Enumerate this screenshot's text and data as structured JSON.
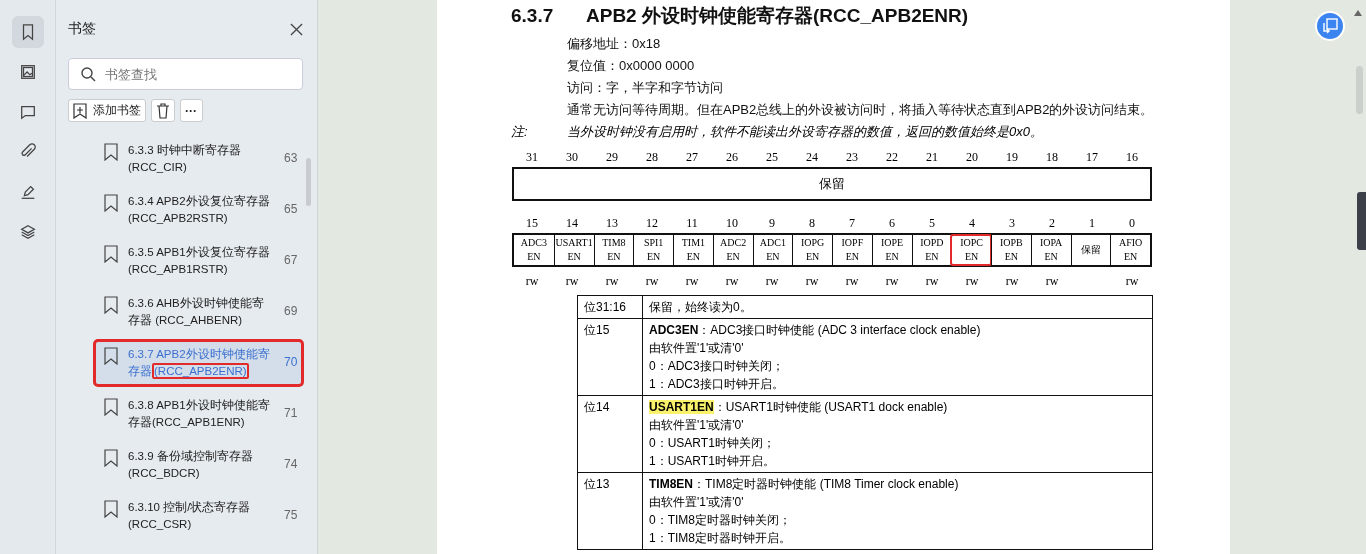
{
  "rail": [
    {
      "kind": "bookmark",
      "selected": true
    },
    {
      "kind": "image",
      "selected": false
    },
    {
      "kind": "comment",
      "selected": false
    },
    {
      "kind": "attachment",
      "selected": false
    },
    {
      "kind": "sign",
      "selected": false
    },
    {
      "kind": "layers",
      "selected": false
    }
  ],
  "panel": {
    "title": "书签",
    "search": {
      "placeholder": "书签查找"
    },
    "add_button": "添加书签",
    "more_button": "···",
    "items": [
      {
        "title": "6.3.3 时钟中断寄存器 (RCC_CIR)",
        "page": "63",
        "selected": false
      },
      {
        "title": "6.3.4 APB2外设复位寄存器 (RCC_APB2RSTR)",
        "page": "65",
        "selected": false
      },
      {
        "title": "6.3.5 APB1外设复位寄存器 (RCC_APB1RSTR)",
        "page": "67",
        "selected": false
      },
      {
        "title": "6.3.6 AHB外设时钟使能寄存器 (RCC_AHBENR)",
        "page": "69",
        "selected": false
      },
      {
        "title": "6.3.7 APB2外设时钟使能寄存器",
        "boxed": "(RCC_APB2ENR)",
        "page": "70",
        "selected": true
      },
      {
        "title": "6.3.8 APB1外设时钟使能寄存器(RCC_APB1ENR)",
        "page": "71",
        "selected": false
      },
      {
        "title": "6.3.9 备份域控制寄存器 (RCC_BDCR)",
        "page": "74",
        "selected": false
      },
      {
        "title": "6.3.10 控制/状态寄存器 (RCC_CSR)",
        "page": "75",
        "selected": false
      }
    ]
  },
  "doc": {
    "number": "6.3.7",
    "title": "APB2 外设时钟使能寄存器(RCC_APB2ENR)",
    "lines": [
      "偏移地址：0x18",
      "复位值：0x0000 0000",
      "访问：字，半字和字节访问",
      "通常无访问等待周期。但在APB2总线上的外设被访问时，将插入等待状态直到APB2的外设访问结束。"
    ],
    "note_label": "注:",
    "note": "当外设时钟没有启用时，软件不能读出外设寄存器的数值，返回的数值始终是0x0。",
    "high_bits": [
      "31",
      "30",
      "29",
      "28",
      "27",
      "26",
      "25",
      "24",
      "23",
      "22",
      "21",
      "20",
      "19",
      "18",
      "17",
      "16"
    ],
    "high_reserved": "保留",
    "low_bits": [
      {
        "bit": "15",
        "name": [
          "ADC3",
          "EN"
        ],
        "access": "rw",
        "marked": false
      },
      {
        "bit": "14",
        "name": [
          "USART1",
          "EN"
        ],
        "access": "rw",
        "marked": false
      },
      {
        "bit": "13",
        "name": [
          "TIM8",
          "EN"
        ],
        "access": "rw",
        "marked": false
      },
      {
        "bit": "12",
        "name": [
          "SPI1",
          "EN"
        ],
        "access": "rw",
        "marked": false
      },
      {
        "bit": "11",
        "name": [
          "TIM1",
          "EN"
        ],
        "access": "rw",
        "marked": false
      },
      {
        "bit": "10",
        "name": [
          "ADC2",
          "EN"
        ],
        "access": "rw",
        "marked": false
      },
      {
        "bit": "9",
        "name": [
          "ADC1",
          "EN"
        ],
        "access": "rw",
        "marked": false
      },
      {
        "bit": "8",
        "name": [
          "IOPG",
          "EN"
        ],
        "access": "rw",
        "marked": false
      },
      {
        "bit": "7",
        "name": [
          "IOPF",
          "EN"
        ],
        "access": "rw",
        "marked": false
      },
      {
        "bit": "6",
        "name": [
          "IOPE",
          "EN"
        ],
        "access": "rw",
        "marked": false
      },
      {
        "bit": "5",
        "name": [
          "IOPD",
          "EN"
        ],
        "access": "rw",
        "marked": false
      },
      {
        "bit": "4",
        "name": [
          "IOPC",
          "EN"
        ],
        "access": "rw",
        "marked": true
      },
      {
        "bit": "3",
        "name": [
          "IOPB",
          "EN"
        ],
        "access": "rw",
        "marked": false
      },
      {
        "bit": "2",
        "name": [
          "IOPA",
          "EN"
        ],
        "access": "rw",
        "marked": false
      },
      {
        "bit": "1",
        "name": [
          "保留"
        ],
        "marked": false
      },
      {
        "bit": "0",
        "name": [
          "AFIO",
          "EN"
        ],
        "access": "rw",
        "marked": false
      }
    ],
    "fields": [
      {
        "bits": "位31:16",
        "lines": [
          "保留，始终读为0。"
        ]
      },
      {
        "bits": "位15",
        "name": "ADC3EN",
        "highlighted": false,
        "desc": "：ADC3接口时钟使能 (ADC 3 interface clock enable)",
        "lines": [
          "由软件置'1'或清'0'",
          "0：ADC3接口时钟关闭；",
          "1：ADC3接口时钟开启。"
        ]
      },
      {
        "bits": "位14",
        "name": "USART1EN",
        "highlighted": true,
        "desc": "：USART1时钟使能 (USART1 dock enable)",
        "lines": [
          "由软件置'1'或清'0'",
          "0：USART1时钟关闭；",
          "1：USART1时钟开启。"
        ]
      },
      {
        "bits": "位13",
        "name": "TIM8EN",
        "highlighted": false,
        "desc": "：TIM8定时器时钟使能 (TIM8 Timer clock enable)",
        "lines": [
          "由软件置'1'或清'0'",
          "0：TIM8定时器时钟关闭；",
          "1：TIM8定时器时钟开启。"
        ]
      }
    ]
  }
}
